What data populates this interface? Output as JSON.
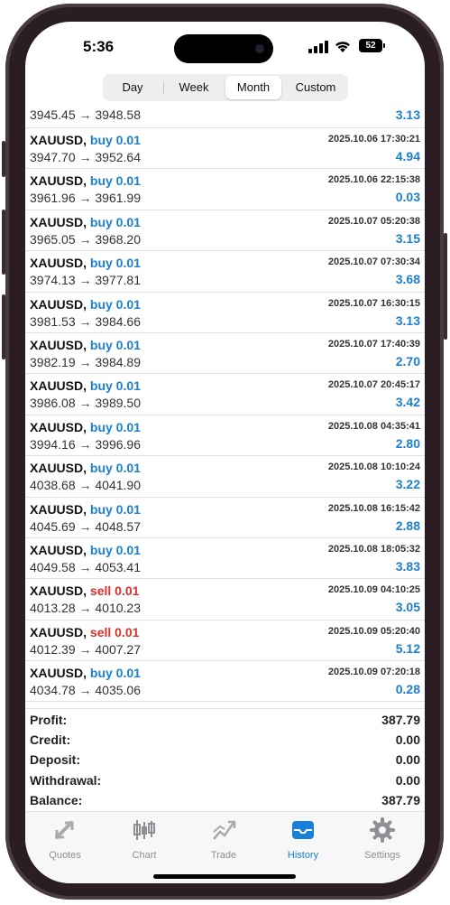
{
  "status": {
    "time": "5:36",
    "battery": "52"
  },
  "segments": [
    "Day",
    "Week",
    "Month",
    "Custom"
  ],
  "active_segment": "Month",
  "first_row": {
    "prices": "3945.45 → 3948.58",
    "profit": "3.13"
  },
  "deals": [
    {
      "symbol": "XAUUSD,",
      "side": "buy 0.01",
      "type": "buy",
      "datetime": "2025.10.06 17:30:21",
      "prices": "3947.70 → 3952.64",
      "profit": "4.94"
    },
    {
      "symbol": "XAUUSD,",
      "side": "buy 0.01",
      "type": "buy",
      "datetime": "2025.10.06 22:15:38",
      "prices": "3961.96 → 3961.99",
      "profit": "0.03"
    },
    {
      "symbol": "XAUUSD,",
      "side": "buy 0.01",
      "type": "buy",
      "datetime": "2025.10.07 05:20:38",
      "prices": "3965.05 → 3968.20",
      "profit": "3.15"
    },
    {
      "symbol": "XAUUSD,",
      "side": "buy 0.01",
      "type": "buy",
      "datetime": "2025.10.07 07:30:34",
      "prices": "3974.13 → 3977.81",
      "profit": "3.68"
    },
    {
      "symbol": "XAUUSD,",
      "side": "buy 0.01",
      "type": "buy",
      "datetime": "2025.10.07 16:30:15",
      "prices": "3981.53 → 3984.66",
      "profit": "3.13"
    },
    {
      "symbol": "XAUUSD,",
      "side": "buy 0.01",
      "type": "buy",
      "datetime": "2025.10.07 17:40:39",
      "prices": "3982.19 → 3984.89",
      "profit": "2.70"
    },
    {
      "symbol": "XAUUSD,",
      "side": "buy 0.01",
      "type": "buy",
      "datetime": "2025.10.07 20:45:17",
      "prices": "3986.08 → 3989.50",
      "profit": "3.42"
    },
    {
      "symbol": "XAUUSD,",
      "side": "buy 0.01",
      "type": "buy",
      "datetime": "2025.10.08 04:35:41",
      "prices": "3994.16 → 3996.96",
      "profit": "2.80"
    },
    {
      "symbol": "XAUUSD,",
      "side": "buy 0.01",
      "type": "buy",
      "datetime": "2025.10.08 10:10:24",
      "prices": "4038.68 → 4041.90",
      "profit": "3.22"
    },
    {
      "symbol": "XAUUSD,",
      "side": "buy 0.01",
      "type": "buy",
      "datetime": "2025.10.08 16:15:42",
      "prices": "4045.69 → 4048.57",
      "profit": "2.88"
    },
    {
      "symbol": "XAUUSD,",
      "side": "buy 0.01",
      "type": "buy",
      "datetime": "2025.10.08 18:05:32",
      "prices": "4049.58 → 4053.41",
      "profit": "3.83"
    },
    {
      "symbol": "XAUUSD,",
      "side": "sell 0.01",
      "type": "sell",
      "datetime": "2025.10.09 04:10:25",
      "prices": "4013.28 → 4010.23",
      "profit": "3.05"
    },
    {
      "symbol": "XAUUSD,",
      "side": "sell 0.01",
      "type": "sell",
      "datetime": "2025.10.09 05:20:40",
      "prices": "4012.39 → 4007.27",
      "profit": "5.12"
    },
    {
      "symbol": "XAUUSD,",
      "side": "buy 0.01",
      "type": "buy",
      "datetime": "2025.10.09 07:20:18",
      "prices": "4034.78 → 4035.06",
      "profit": "0.28"
    }
  ],
  "summary": [
    {
      "label": "Profit:",
      "value": "387.79"
    },
    {
      "label": "Credit:",
      "value": "0.00"
    },
    {
      "label": "Deposit:",
      "value": "0.00"
    },
    {
      "label": "Withdrawal:",
      "value": "0.00"
    },
    {
      "label": "Balance:",
      "value": "387.79"
    }
  ],
  "tabs": [
    {
      "label": "Quotes",
      "icon": "quotes-icon"
    },
    {
      "label": "Chart",
      "icon": "chart-icon"
    },
    {
      "label": "Trade",
      "icon": "trade-icon"
    },
    {
      "label": "History",
      "icon": "history-icon"
    },
    {
      "label": "Settings",
      "icon": "settings-icon"
    }
  ],
  "active_tab": "History",
  "colors": {
    "accent": "#1a7fd6",
    "sell": "#d9312b",
    "frame": "#2a1e24"
  }
}
